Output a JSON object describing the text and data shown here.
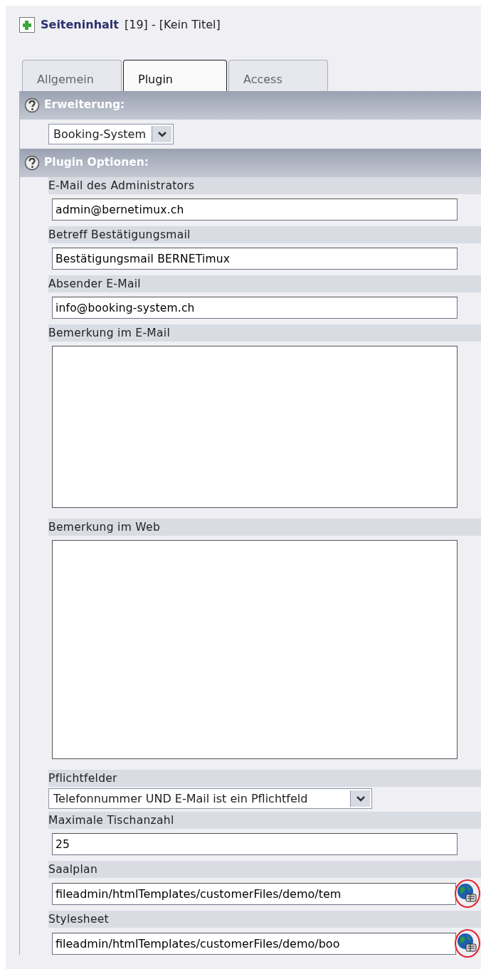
{
  "header": {
    "title": "Seiteninhalt",
    "detail": "[19] - [Kein Titel]"
  },
  "tabs": [
    {
      "label": "Allgemein",
      "selected": false
    },
    {
      "label": "Plugin",
      "selected": true
    },
    {
      "label": "Access",
      "selected": false
    }
  ],
  "sections": [
    {
      "title": "Erweiterung:",
      "fields": [
        {
          "kind": "select",
          "value": "Booking-System"
        }
      ]
    },
    {
      "title": "Plugin Optionen:",
      "fields": [
        {
          "kind": "text",
          "label": "E-Mail des Administrators",
          "value": "admin@bernetimux.ch"
        },
        {
          "kind": "text",
          "label": "Betreff Bestätigungsmail",
          "value": "Bestätigungsmail BERNETimux"
        },
        {
          "kind": "text",
          "label": "Absender E-Mail",
          "value": "info@booking-system.ch"
        },
        {
          "kind": "textarea",
          "label": "Bemerkung im E-Mail"
        },
        {
          "kind": "textarea",
          "label": "Bemerkung im Web"
        },
        {
          "kind": "select",
          "label": "Pflichtfelder",
          "value": "Telefonnummer UND E-Mail ist ein Pflichtfeld"
        },
        {
          "kind": "text",
          "label": "Maximale Tischanzahl",
          "value": "25"
        },
        {
          "kind": "file",
          "label": "Saalplan",
          "value": "fileadmin/htmlTemplates/customerFiles/demo/tem",
          "highlighted": true
        },
        {
          "kind": "file",
          "label": "Stylesheet",
          "value": "fileadmin/htmlTemplates/customerFiles/demo/boo",
          "highlighted": true
        }
      ]
    }
  ]
}
